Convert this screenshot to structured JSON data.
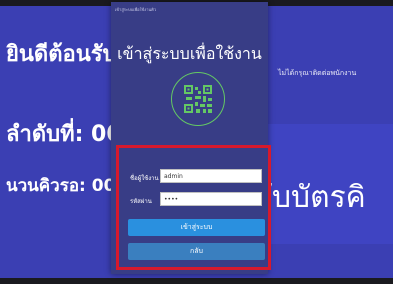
{
  "background": {
    "welcome": "ยินดีต้อนรับ",
    "queue_number_label": "ลำดับที่: 00",
    "queue_wait_label": "นวนคิวรอ: 00",
    "ticket_text": "ับบัตรคิ",
    "notice_text": "ไม่ได้กรุณาติดต่อพนักงาน"
  },
  "login": {
    "caption": "เข้าสู่ระบบเพื่อใช้งานคิว",
    "title": "เข้าสู่ระบบเพื่อใช้งาน",
    "username_label": "ชื่อผู้ใช้งาน",
    "username_value": "admin",
    "password_label": "รหัสผ่าน",
    "password_value": "••••",
    "login_button": "เข้าสู่ระบบ",
    "back_button": "กลับ"
  },
  "icons": {
    "qr": "qr-code-icon"
  },
  "colors": {
    "screen_bg": "#3b3fb3",
    "modal_bg": "#383d86",
    "highlight": "#d7192c",
    "qr_green": "#64c864",
    "login_button": "#2a90df"
  }
}
